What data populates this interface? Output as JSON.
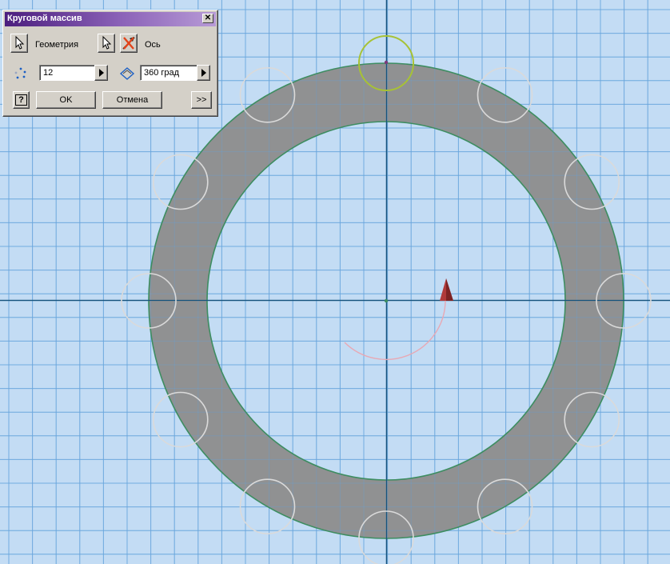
{
  "dialog": {
    "title": "Круговой массив",
    "close_label": "✕",
    "geometry_label": "Геометрия",
    "axis_label": "Ось",
    "count_value": "12",
    "angle_value": "360 град",
    "ok_label": "OK",
    "cancel_label": "Отмена",
    "more_label": ">>",
    "help_label": "?"
  },
  "icons": {
    "geometry_select": "cursor-arrow-icon",
    "axis_select": "cursor-arrow-icon",
    "axis_flip": "flip-direction-icon",
    "count": "pattern-count-icon",
    "angle": "angle-icon",
    "help": "help-icon",
    "count_arrow": "right-arrow-icon",
    "angle_arrow": "right-arrow-icon"
  },
  "colors": {
    "background": "#c3dcf4",
    "grid": "#6aa6dd",
    "axis": "#16547d",
    "ring_fill": "#8d8c8c",
    "ring_edge": "#3d8d61",
    "preview_circles": "#dadada",
    "selected_circle": "#a7c235",
    "direction_arrow": "#b03a3a",
    "rotation_arc": "#e8a8b4",
    "title_gradient_start": "#4b1e7e",
    "title_gradient_end": "#b79ad6"
  }
}
